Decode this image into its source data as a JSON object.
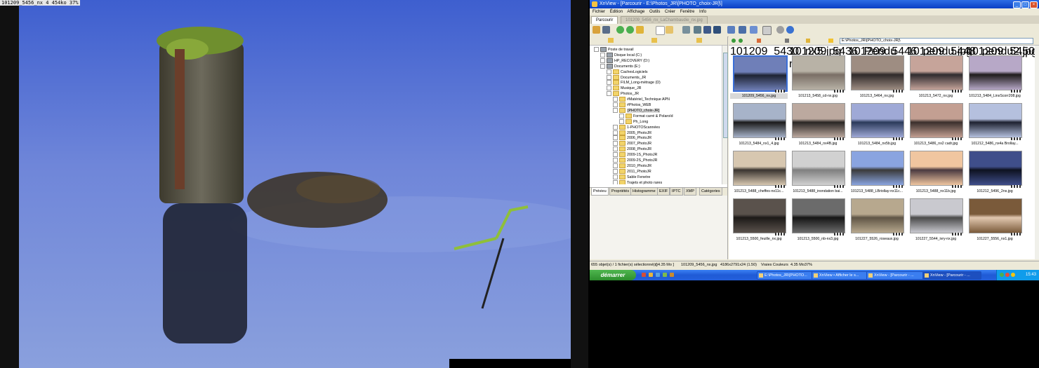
{
  "viewer": {
    "overlay_text": "101209_5456_nx 4 454ko 37%"
  },
  "window": {
    "title": "XnView - [Parcourir - E:\\Photos_JR\\[PHOTO_choix-JR]\\]",
    "menu": [
      "Fichier",
      "Édition",
      "Affichage",
      "Outils",
      "Créer",
      "Fenêtre",
      "Info"
    ],
    "tabs": [
      "Parcourir",
      "101209_5456_nx_LaChambaudie_nx.jpg"
    ]
  },
  "tree": {
    "items": [
      {
        "label": "Poste de travail",
        "level": 0,
        "icon": "computer"
      },
      {
        "label": "Disque local (C:)",
        "level": 1,
        "icon": "drive"
      },
      {
        "label": "HP_RECOVERY (D:)",
        "level": 1,
        "icon": "drive"
      },
      {
        "label": "Documents (E:)",
        "level": 1,
        "icon": "drive"
      },
      {
        "label": "CachesLogiciels",
        "level": 2,
        "icon": "folder"
      },
      {
        "label": "Documents_JR",
        "level": 2,
        "icon": "folder"
      },
      {
        "label": "FILM_Long-métrage (D)",
        "level": 2,
        "icon": "folder"
      },
      {
        "label": "Musique_JR",
        "level": 2,
        "icon": "folder"
      },
      {
        "label": "Photos_JR",
        "level": 2,
        "icon": "folder"
      },
      {
        "label": "#Matériel_Technique APN",
        "level": 3,
        "icon": "folder"
      },
      {
        "label": "#Photos_WEB",
        "level": 3,
        "icon": "folder"
      },
      {
        "label": "[PHOTO_choix-JR]",
        "level": 3,
        "icon": "folder",
        "selected": true
      },
      {
        "label": "Format carré & Polaroïd",
        "level": 4,
        "icon": "folder"
      },
      {
        "label": "Ph_Long",
        "level": 4,
        "icon": "folder"
      },
      {
        "label": "1-PHOTOScannées",
        "level": 3,
        "icon": "folder"
      },
      {
        "label": "2005_PhotoJR",
        "level": 3,
        "icon": "folder"
      },
      {
        "label": "2006_PhotoJR",
        "level": 3,
        "icon": "folder"
      },
      {
        "label": "2007_PhotoJR",
        "level": 3,
        "icon": "folder"
      },
      {
        "label": "2008_PhotoJR",
        "level": 3,
        "icon": "folder"
      },
      {
        "label": "2009-1S_PhotoJR",
        "level": 3,
        "icon": "folder"
      },
      {
        "label": "2009-2S_PhotoJR",
        "level": 3,
        "icon": "folder"
      },
      {
        "label": "2010_PhotoJR",
        "level": 3,
        "icon": "folder"
      },
      {
        "label": "2011_PhotoJR",
        "level": 3,
        "icon": "folder"
      },
      {
        "label": "Sable Fenetre",
        "level": 3,
        "icon": "folder"
      },
      {
        "label": "Trajets et photo rares",
        "level": 3,
        "icon": "folder"
      }
    ]
  },
  "info_tabs": [
    "Prévieu",
    "Propriétés",
    "Histogramme",
    "EXIF",
    "IPTC",
    "XMP",
    "Catégories"
  ],
  "address": "E:\\Photos_JR\\[PHOTO_choix-JR]\\",
  "thumbnails": {
    "top_row": [
      "101209_5430_nx5.jpg",
      "101209_5436_Pendu nx.jpg",
      "101209_5446_pendu.jpg",
      "101209_5448_pendu2.jpg",
      "101209_5450_nx_croisé.jpg"
    ],
    "rows": [
      [
        "101209_5456_nx.jpg",
        "101213_5458_cd-nx.jpg",
        "101213_5464_nx.jpg",
        "101213_5472_nx.jpg",
        "101213_5484_LinxScorr208.jpg"
      ],
      [
        "101213_5484_nx1_4.jpg",
        "101213_5484_nx4B.jpg",
        "101213_5484_nx5b.jpg",
        "101213_5486_nx2 cadr.jpg",
        "101212_5486_nx4a Brollay..."
      ],
      [
        "101213_5488_cheffes-nx11c...",
        "101213_5488_inondation bai...",
        "101213_5488_LBriollay-nx11c...",
        "101213_5488_nx11b.jpg",
        "101212_5496_2nx.jpg"
      ],
      [
        "101213_5500_feuille_nx.jpg",
        "101213_5500_nb-nx3.jpg",
        "101227_5526_roseaux.jpg",
        "101227_5544_ivry-nx.jpg",
        "101227_5556_nx1.jpg"
      ]
    ]
  },
  "status": {
    "objects": "655 objet(s) / 1 fichier(s) sélectionné(s)",
    "size": "[ 4.35 Mo ]",
    "file": "101209_5456_nx.jpg",
    "dims": "4186x2791x24 (1.50)",
    "colors": "Vraies Couleurs",
    "mb": "4.35 Mo",
    "zoom": "37%"
  },
  "taskbar": {
    "start": "démarrer",
    "tasks": [
      "E:\\Photos_JR\\[PHOTO...",
      "XnView • Afficher le s...",
      "XnView - [Parcourir - ...",
      "XnView - [Parcourir - ..."
    ],
    "clock": "15:43"
  }
}
